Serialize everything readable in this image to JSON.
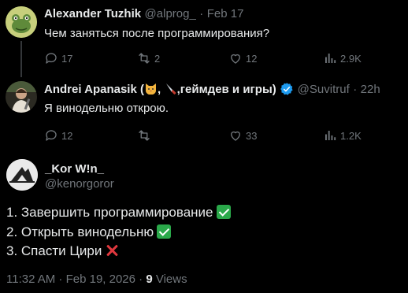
{
  "colors": {
    "background": "#000000",
    "text": "#e7e9ea",
    "muted": "#71767b",
    "verified": "#1d9bf0",
    "check": "#2aa84a",
    "cross": "#e0383e"
  },
  "tweets": [
    {
      "author": "Alexander Tuzhik",
      "handle": "@alprog_",
      "separator": "·",
      "date": "Feb 17",
      "text": "Чем заняться после программирования?",
      "actions": {
        "replies": "17",
        "reposts": "2",
        "likes": "12",
        "views": "2.9K"
      },
      "avatar_icon": "frog-avatar-icon"
    },
    {
      "author_prefix": "Andrei Apanasik (",
      "author_mid": ",",
      "author_suffix": ",геймдев и игры)",
      "author_emojis": [
        "cat-emoji-icon",
        "knife-emoji-icon"
      ],
      "verified_icon": "verified-badge-icon",
      "handle": "@Suvitruf",
      "separator": "·",
      "date": "22h",
      "text": "Я винодельню открою.",
      "actions": {
        "replies": "12",
        "reposts": "",
        "likes": "33",
        "views": "1.2K"
      },
      "avatar_icon": "person-avatar-icon"
    }
  ],
  "main_tweet": {
    "author": "_Kor W!n_",
    "handle": "@kenorgoror",
    "lines": [
      "1. Завершить программирование",
      "2. Открыть винодельню",
      "3. Спасти Цири"
    ],
    "line_marks": [
      "check-mark-icon",
      "check-mark-icon",
      "cross-mark-icon"
    ],
    "timestamp": "11:32 AM · Feb 19, 2026 ·",
    "views_count": "9",
    "views_label": "Views"
  }
}
